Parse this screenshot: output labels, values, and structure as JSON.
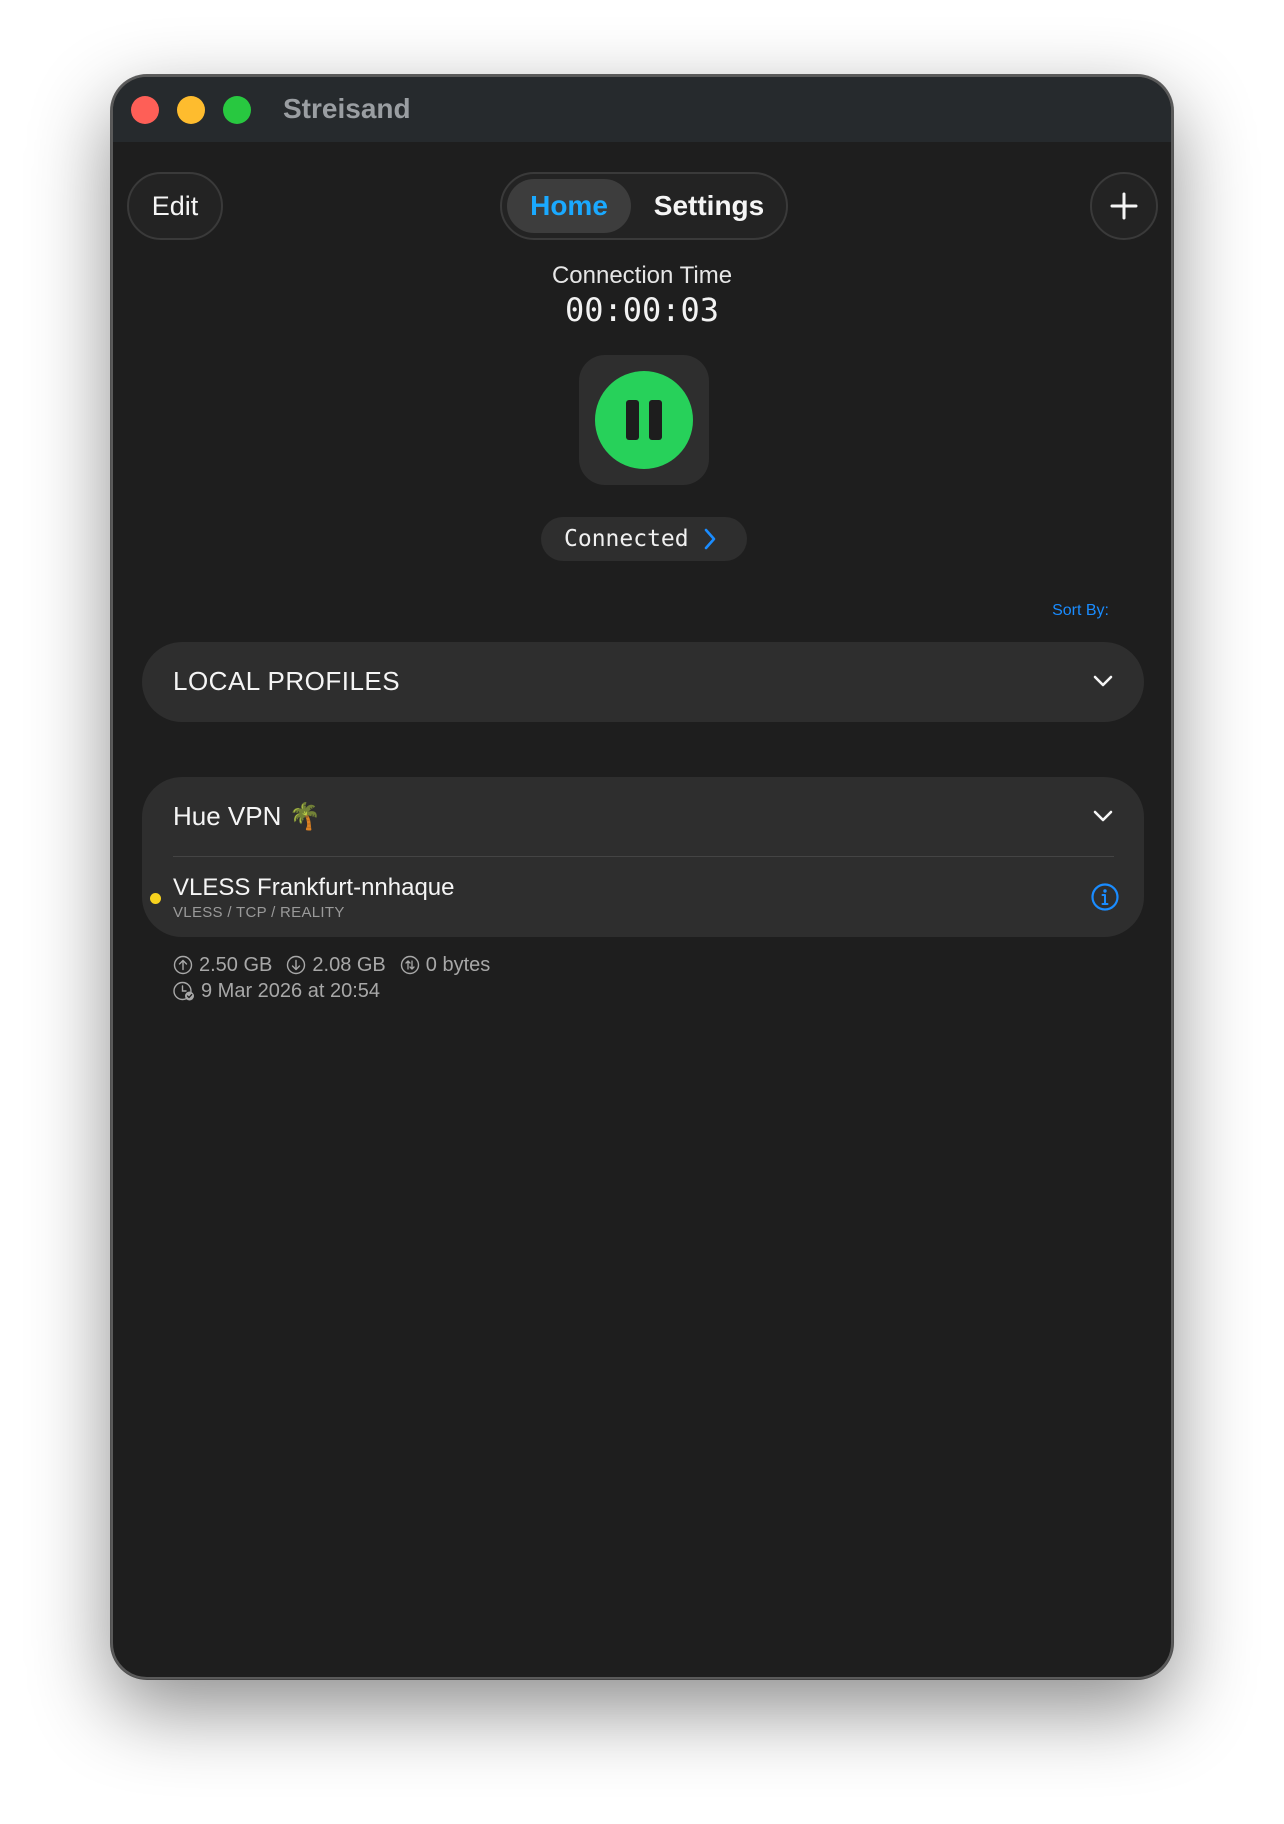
{
  "window": {
    "title": "Streisand"
  },
  "toolbar": {
    "edit_label": "Edit",
    "add_icon": "plus-icon"
  },
  "tabs": [
    {
      "label": "Home",
      "active": true
    },
    {
      "label": "Settings",
      "active": false
    }
  ],
  "connection": {
    "label": "Connection Time",
    "time": "00:00:03",
    "status": "Connected",
    "power_icon": "pause-icon"
  },
  "sort": {
    "label": "Sort By:"
  },
  "groups": [
    {
      "title": "LOCAL PROFILES",
      "expanded": false
    },
    {
      "title": "Hue VPN 🌴",
      "expanded": true,
      "profile": {
        "name": "VLESS Frankfurt-nnhaque",
        "subtitle": "VLESS / TCP / REALITY",
        "upload": "2.50 GB",
        "download": "2.08 GB",
        "total": "0 bytes",
        "date": "9 Mar 2026 at 20:54"
      }
    }
  ],
  "colors": {
    "accent": "#1aa9ff",
    "connected": "#27d15a",
    "status_dot": "#f7d21e",
    "background": "#1e1e1e"
  }
}
